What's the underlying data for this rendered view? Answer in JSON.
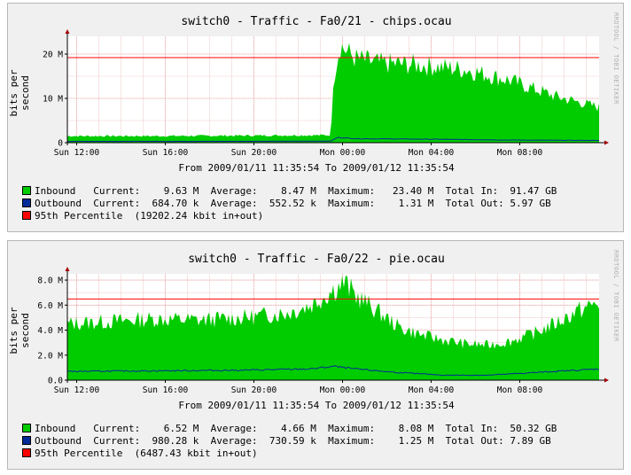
{
  "colors": {
    "inbound": "#00cc00",
    "outbound": "#002a97",
    "percentile": "#ff0000",
    "grid": "#e8a8a8",
    "panel": "#f0f0f0"
  },
  "watermark": "RRDTOOL / TOBI OETIKER",
  "chart_data": [
    {
      "type": "area",
      "title": "switch0 - Traffic - Fa0/21 - chips.ocau",
      "ylabel": "bits per second",
      "ylim": [
        0,
        24000000
      ],
      "y_ticks": [
        {
          "v": 0,
          "label": "0"
        },
        {
          "v": 10000000,
          "label": "10 M"
        },
        {
          "v": 20000000,
          "label": "20 M"
        }
      ],
      "x_ticks": [
        "Sun 12:00",
        "Sun 16:00",
        "Sun 20:00",
        "Mon 00:00",
        "Mon 04:00",
        "Mon 08:00"
      ],
      "x_tick_hours": [
        0.42,
        4.42,
        8.42,
        12.42,
        16.42,
        20.42
      ],
      "x_range_hours": [
        0,
        24
      ],
      "date_range": "From 2009/01/11 11:35:54 To 2009/01/12 11:35:54",
      "percentile_95": 19202240,
      "series": [
        {
          "name": "Inbound",
          "x_hours": [
            0,
            4,
            8,
            11.9,
            12,
            12.3,
            13,
            14,
            16,
            18,
            20,
            22,
            24
          ],
          "values": [
            1500000,
            1500000,
            1600000,
            1700000,
            14000000,
            22000000,
            19000000,
            18000000,
            17500000,
            16500000,
            14000000,
            10500000,
            8000000
          ]
        },
        {
          "name": "Outbound",
          "x_hours": [
            0,
            6,
            11.9,
            12.2,
            13,
            16,
            20,
            24
          ],
          "values": [
            300000,
            300000,
            350000,
            1200000,
            900000,
            800000,
            600000,
            500000
          ]
        }
      ],
      "legend": [
        {
          "color_key": "inbound",
          "text": "Inbound   Current:    9.63 M  Average:    8.47 M  Maximum:   23.40 M  Total In:  91.47 GB"
        },
        {
          "color_key": "outbound",
          "text": "Outbound  Current:  684.70 k  Average:  552.52 k  Maximum:    1.31 M  Total Out: 5.97 GB"
        },
        {
          "color_key": "percentile",
          "text": "95th Percentile  (19202.24 kbit in+out)"
        }
      ]
    },
    {
      "type": "area",
      "title": "switch0 - Traffic - Fa0/22 - pie.ocau",
      "ylabel": "bits per second",
      "ylim": [
        0,
        8500000
      ],
      "y_ticks": [
        {
          "v": 0,
          "label": "0.0"
        },
        {
          "v": 2000000,
          "label": "2.0 M"
        },
        {
          "v": 4000000,
          "label": "4.0 M"
        },
        {
          "v": 6000000,
          "label": "6.0 M"
        },
        {
          "v": 8000000,
          "label": "8.0 M"
        }
      ],
      "x_ticks": [
        "Sun 12:00",
        "Sun 16:00",
        "Sun 20:00",
        "Mon 00:00",
        "Mon 04:00",
        "Mon 08:00"
      ],
      "x_tick_hours": [
        0.42,
        4.42,
        8.42,
        12.42,
        16.42,
        20.42
      ],
      "x_range_hours": [
        0,
        24
      ],
      "date_range": "From 2009/01/11 11:35:54 To 2009/01/12 11:35:54",
      "percentile_95": 6487430,
      "series": [
        {
          "name": "Inbound",
          "x_hours": [
            0,
            2,
            4,
            6,
            8,
            10,
            11,
            12,
            12.5,
            13,
            14,
            15,
            16,
            17,
            18,
            19,
            20,
            21,
            22,
            23,
            24
          ],
          "values": [
            4500000,
            4700000,
            4900000,
            4800000,
            5000000,
            5400000,
            6000000,
            7200000,
            7800000,
            6800000,
            5500000,
            4200000,
            3600000,
            3200000,
            2900000,
            2800000,
            3100000,
            3700000,
            4500000,
            5500000,
            6200000
          ]
        },
        {
          "name": "Outbound",
          "x_hours": [
            0,
            4,
            8,
            11,
            12,
            13,
            15,
            17,
            19,
            21,
            24
          ],
          "values": [
            700000,
            750000,
            800000,
            900000,
            1100000,
            900000,
            600000,
            400000,
            400000,
            600000,
            900000
          ]
        }
      ],
      "legend": [
        {
          "color_key": "inbound",
          "text": "Inbound   Current:    6.52 M  Average:    4.66 M  Maximum:    8.08 M  Total In:  50.32 GB"
        },
        {
          "color_key": "outbound",
          "text": "Outbound  Current:  980.28 k  Average:  730.59 k  Maximum:    1.25 M  Total Out: 7.89 GB"
        },
        {
          "color_key": "percentile",
          "text": "95th Percentile  (6487.43 kbit in+out)"
        }
      ]
    }
  ]
}
